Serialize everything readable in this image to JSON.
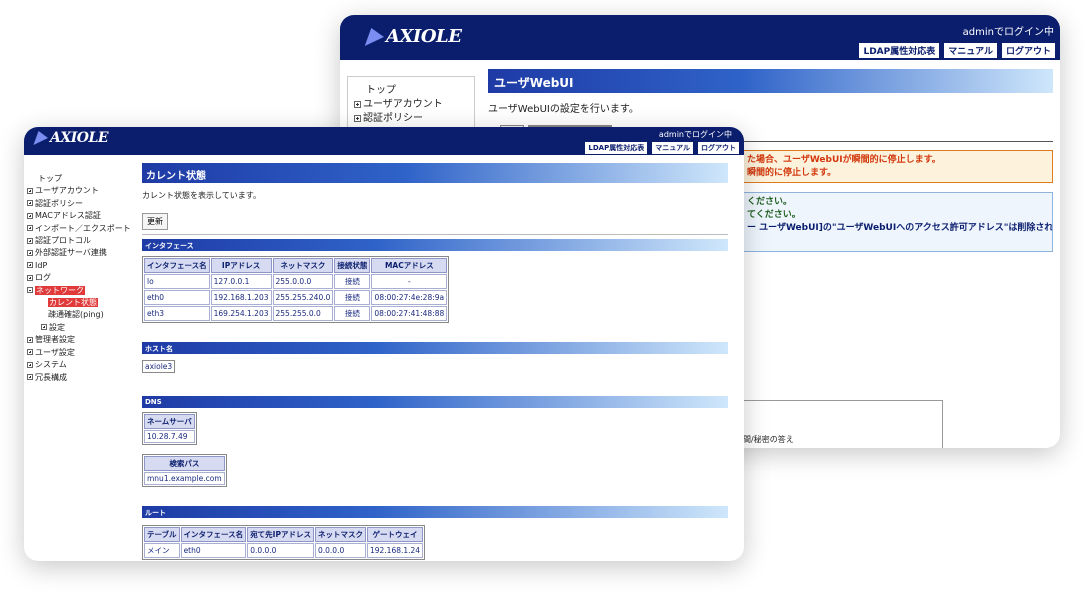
{
  "header": {
    "logo": "AXIOLE",
    "login_status": "adminでログイン中",
    "links": [
      "LDAP属性対応表",
      "マニュアル",
      "ログアウト"
    ]
  },
  "back_window": {
    "sidebar": {
      "top": "トップ",
      "items": [
        "ユーザアカウント",
        "認証ポリシー"
      ]
    },
    "page_title": "ユーザWebUI",
    "page_description": "ユーザWebUIの設定を行います。",
    "warning_lines": [
      "た場合、ユーザWebUIが瞬間的に停止します。",
      "瞬間的に停止します。"
    ],
    "info_lines": [
      "ください。",
      "てください。",
      "ー ユーザWebUI]の\"ユーザWebUIへのアクセス許可アドレス\"は削除され"
    ],
    "box_text": "間/秘密の答え"
  },
  "front_window": {
    "sidebar": {
      "top": "トップ",
      "items": [
        {
          "label": "ユーザアカウント",
          "state": "plus"
        },
        {
          "label": "認証ポリシー",
          "state": "plus"
        },
        {
          "label": "MACアドレス認証",
          "state": "plus"
        },
        {
          "label": "インポート／エクスポート",
          "state": "plus"
        },
        {
          "label": "認証プロトコル",
          "state": "plus"
        },
        {
          "label": "外部認証サーバ連携",
          "state": "plus"
        },
        {
          "label": "IdP",
          "state": "plus"
        },
        {
          "label": "ログ",
          "state": "plus"
        },
        {
          "label": "ネットワーク",
          "state": "minus"
        }
      ],
      "network_children": [
        "カレント状態",
        "疎通確認(ping)"
      ],
      "network_settings": "設定",
      "items_after": [
        "管理者設定",
        "ユーザ設定",
        "システム",
        "冗長構成"
      ]
    },
    "page_title": "カレント状態",
    "page_description": "カレント状態を表示しています。",
    "refresh_label": "更新",
    "interfaces": {
      "heading": "インタフェース",
      "columns": [
        "インタフェース名",
        "IPアドレス",
        "ネットマスク",
        "接続状態",
        "MACアドレス"
      ],
      "rows": [
        [
          "lo",
          "127.0.0.1",
          "255.0.0.0",
          "接続",
          "-"
        ],
        [
          "eth0",
          "192.168.1.203",
          "255.255.240.0",
          "接続",
          "08:00:27:4e:28:9a"
        ],
        [
          "eth3",
          "169.254.1.203",
          "255.255.0.0",
          "接続",
          "08:00:27:41:48:88"
        ]
      ]
    },
    "hostname": {
      "heading": "ホスト名",
      "value": "axiole3"
    },
    "dns": {
      "heading": "DNS",
      "nameserver_header": "ネームサーバ",
      "nameserver": "10.28.7.49",
      "search_header": "検索パス",
      "search": "mnu1.example.com"
    },
    "routes": {
      "heading": "ルート",
      "columns": [
        "テーブル",
        "インタフェース名",
        "宛て先IPアドレス",
        "ネットマスク",
        "ゲートウェイ"
      ],
      "rows": [
        [
          "メイン",
          "eth0",
          "0.0.0.0",
          "0.0.0.0",
          "192.168.1.24"
        ]
      ]
    }
  }
}
